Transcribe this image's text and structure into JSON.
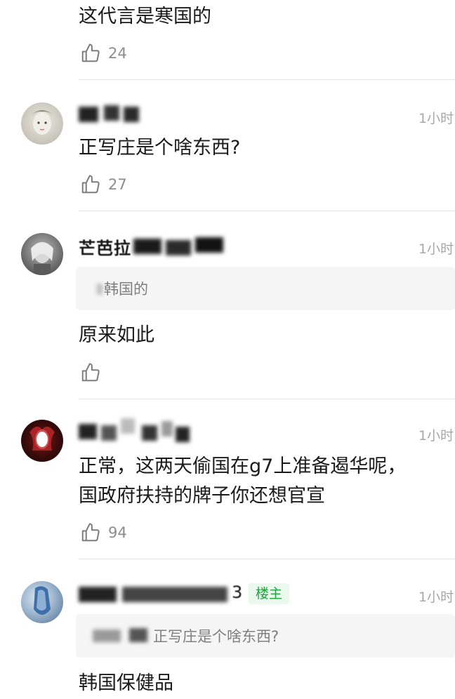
{
  "top_comment": {
    "text": "这代言是寒国的",
    "likes": "24"
  },
  "comments": [
    {
      "username": "",
      "time": "1小时",
      "text": "正写庄是个啥东西?",
      "likes": "27"
    },
    {
      "username": "芒芭拉",
      "time": "1小时",
      "quote": "韩国的",
      "text": "原来如此",
      "likes": ""
    },
    {
      "username": "",
      "time": "1小时",
      "text_lines": [
        "正常，这两天偷国在g7上准备遏华呢，",
        "国政府扶持的牌子你还想官宣"
      ],
      "likes": "94"
    },
    {
      "username": "",
      "username_suffix": "3",
      "badge": "楼主",
      "time": "1小时",
      "quote": "正写庄是个啥东西?",
      "text": "韩国保健品"
    }
  ],
  "icons": {
    "like": "thumbs-up-icon"
  },
  "colors": {
    "badge_text": "#1fa33d",
    "badge_bg": "#eaf8ee",
    "muted": "#8c8c8c",
    "time": "#a7a7a7",
    "quote_bg": "#f5f5f5"
  }
}
